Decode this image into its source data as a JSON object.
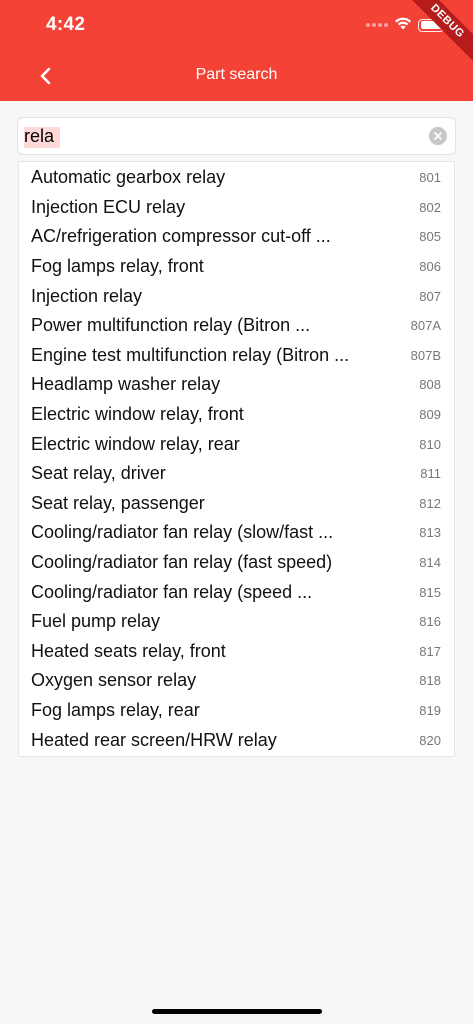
{
  "status_bar": {
    "time": "4:42",
    "debug_label": "DEBUG"
  },
  "header": {
    "title": "Part search"
  },
  "search": {
    "value": "rela"
  },
  "results": [
    {
      "name": "Automatic gearbox relay",
      "code": "801"
    },
    {
      "name": "Injection ECU relay",
      "code": "802"
    },
    {
      "name": "AC/refrigeration compressor cut-off ...",
      "code": "805"
    },
    {
      "name": "Fog lamps relay, front",
      "code": "806"
    },
    {
      "name": "Injection relay",
      "code": "807"
    },
    {
      "name": "Power multifunction relay (Bitron ...",
      "code": "807A"
    },
    {
      "name": "Engine test multifunction relay (Bitron ...",
      "code": "807B"
    },
    {
      "name": "Headlamp washer relay",
      "code": "808"
    },
    {
      "name": "Electric window relay, front",
      "code": "809"
    },
    {
      "name": "Electric window relay, rear",
      "code": "810"
    },
    {
      "name": "Seat relay, driver",
      "code": "811"
    },
    {
      "name": "Seat relay, passenger",
      "code": "812"
    },
    {
      "name": "Cooling/radiator fan relay (slow/fast ...",
      "code": "813"
    },
    {
      "name": "Cooling/radiator fan relay (fast speed)",
      "code": "814"
    },
    {
      "name": "Cooling/radiator fan relay (speed ...",
      "code": "815"
    },
    {
      "name": "Fuel pump relay",
      "code": "816"
    },
    {
      "name": "Heated seats relay, front",
      "code": "817"
    },
    {
      "name": "Oxygen sensor relay",
      "code": "818"
    },
    {
      "name": "Fog lamps relay, rear",
      "code": "819"
    },
    {
      "name": "Heated rear screen/HRW relay",
      "code": "820"
    }
  ],
  "icons": {
    "back": "chevron-left-icon",
    "clear": "clear-circle-icon",
    "wifi": "wifi-icon",
    "battery": "battery-icon",
    "signal": "cellular-signal-icon"
  },
  "colors": {
    "app_bar": "#f44336",
    "debug_banner": "#b71c1c",
    "background": "#f7f7f7",
    "search_highlight": "#ffd8d8"
  }
}
